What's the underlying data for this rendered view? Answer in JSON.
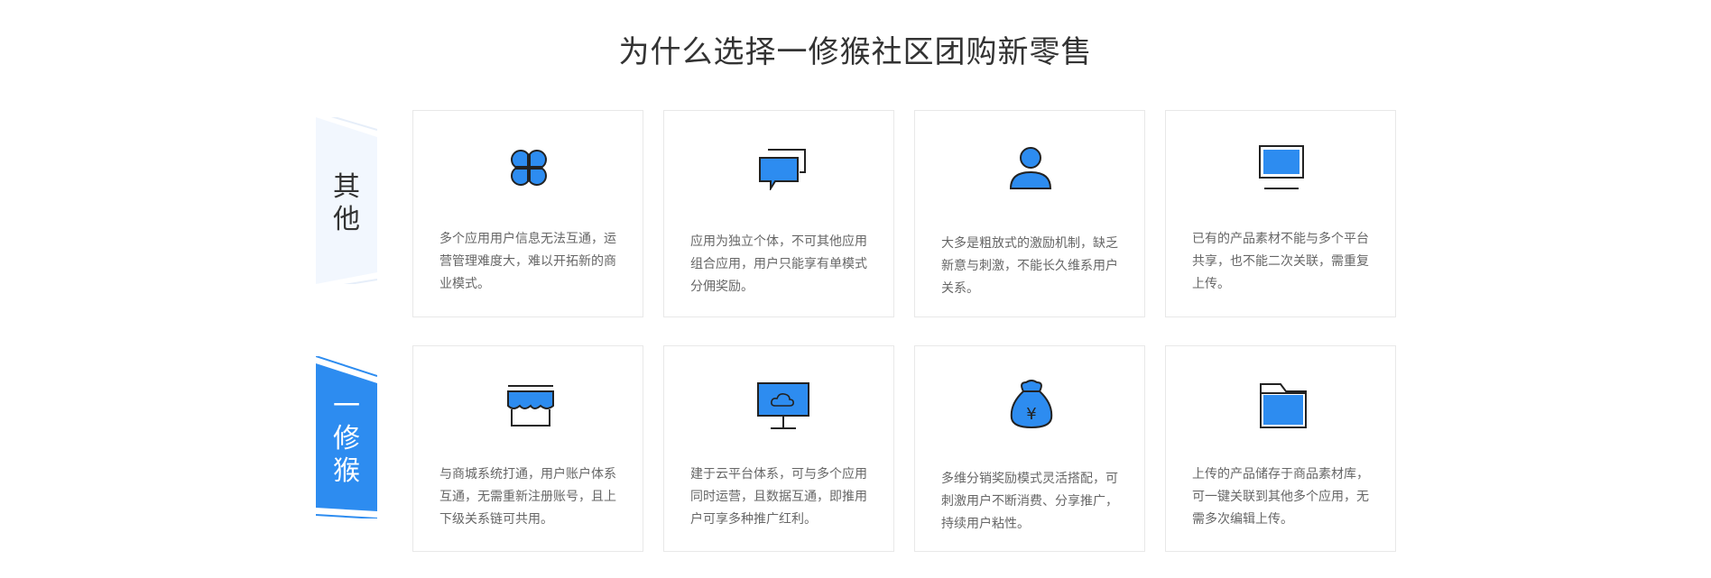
{
  "title": "为什么选择一修猴社区团购新零售",
  "rows": [
    {
      "label_lines": [
        "其",
        "他"
      ],
      "cards": [
        {
          "icon": "app-grid-icon",
          "text": "多个应用用户信息无法互通，运营管理难度大，难以开拓新的商业模式。"
        },
        {
          "icon": "chat-bubbles-icon",
          "text": "应用为独立个体，不可其他应用组合应用，用户只能享有单模式分佣奖励。"
        },
        {
          "icon": "user-icon",
          "text": "大多是粗放式的激励机制，缺乏新意与刺激，不能长久维系用户关系。"
        },
        {
          "icon": "monitor-icon",
          "text": "已有的产品素材不能与多个平台共享，也不能二次关联，需重复上传。"
        }
      ]
    },
    {
      "label_lines": [
        "一",
        "修",
        "猴"
      ],
      "cards": [
        {
          "icon": "storefront-icon",
          "text": "与商城系统打通，用户账户体系互通，无需重新注册账号，且上下级关系链可共用。"
        },
        {
          "icon": "cloud-monitor-icon",
          "text": "建于云平台体系，可与多个应用同时运营，且数据互通，即推用户可享多种推广红利。"
        },
        {
          "icon": "money-bag-icon",
          "text": "多维分销奖励模式灵活搭配，可刺激用户不断消费、分享推广，持续用户粘性。"
        },
        {
          "icon": "folder-icon",
          "text": "上传的产品储存于商品素材库，可一键关联到其他多个应用，无需多次编辑上传。"
        }
      ]
    }
  ],
  "colors": {
    "accent": "#2d8cf0",
    "side_light": "#f2f7fe",
    "card_border": "#e8e8e8"
  }
}
